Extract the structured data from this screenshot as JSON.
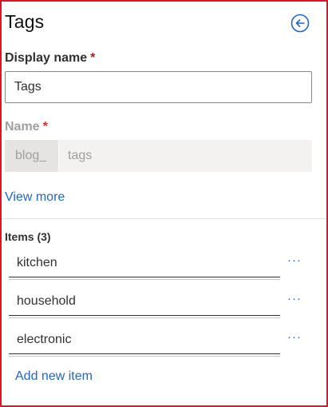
{
  "panel": {
    "title": "Tags",
    "back_icon": "back-arrow-circle-icon",
    "accent_color": "#2266cc",
    "border_color": "#e81123"
  },
  "display_name": {
    "label": "Display name",
    "required_mark": "*",
    "value": "Tags"
  },
  "name": {
    "label": "Name",
    "required_mark": "*",
    "prefix": "blog_",
    "value": "tags"
  },
  "view_more_label": "View more",
  "items": {
    "heading": "Items (3)",
    "list": [
      {
        "value": "kitchen",
        "menu_icon": "ellipsis-icon"
      },
      {
        "value": "household",
        "menu_icon": "ellipsis-icon"
      },
      {
        "value": "electronic",
        "menu_icon": "ellipsis-icon"
      }
    ],
    "add_label": "Add new item"
  }
}
